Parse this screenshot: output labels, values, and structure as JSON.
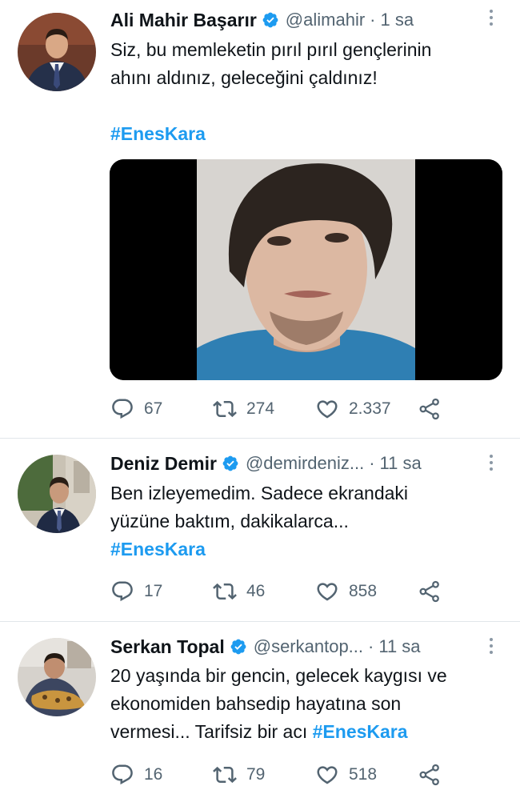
{
  "tweets": [
    {
      "name": "Ali Mahir Başarır",
      "handle": "@alimahir",
      "time": "1 sa",
      "line1": "Siz, bu memleketin pırıl pırıl gençlerinin",
      "line2": "ahını aldınız, geleceğini çaldınız!",
      "hashtag": "#EnesKara",
      "replies": "67",
      "retweets": "274",
      "likes": "2.337"
    },
    {
      "name": "Deniz Demir",
      "handle": "@demirdeniz...",
      "time": "11 sa",
      "line1": "Ben izleyemedim. Sadece ekrandaki",
      "line2": "yüzüne baktım, dakikalarca...",
      "hashtag": "#EnesKara",
      "replies": "17",
      "retweets": "46",
      "likes": "858"
    },
    {
      "name": "Serkan Topal",
      "handle": "@serkantop...",
      "time": "11 sa",
      "line1": "20 yaşında bir gencin, gelecek kaygısı ve",
      "line2": "ekonomiden bahsedip hayatına son",
      "line3": "vermesi... Tarifsiz bir acı",
      "hashtag": "#EnesKara",
      "replies": "16",
      "retweets": "79",
      "likes": "518"
    }
  ],
  "colors": {
    "accent": "#1d9bf0",
    "text": "#0f1419",
    "muted": "#536471",
    "divider": "#e1e6ea"
  },
  "icons": [
    "reply-icon",
    "retweet-icon",
    "like-icon",
    "share-icon",
    "verified-badge-icon",
    "more-options-icon"
  ]
}
